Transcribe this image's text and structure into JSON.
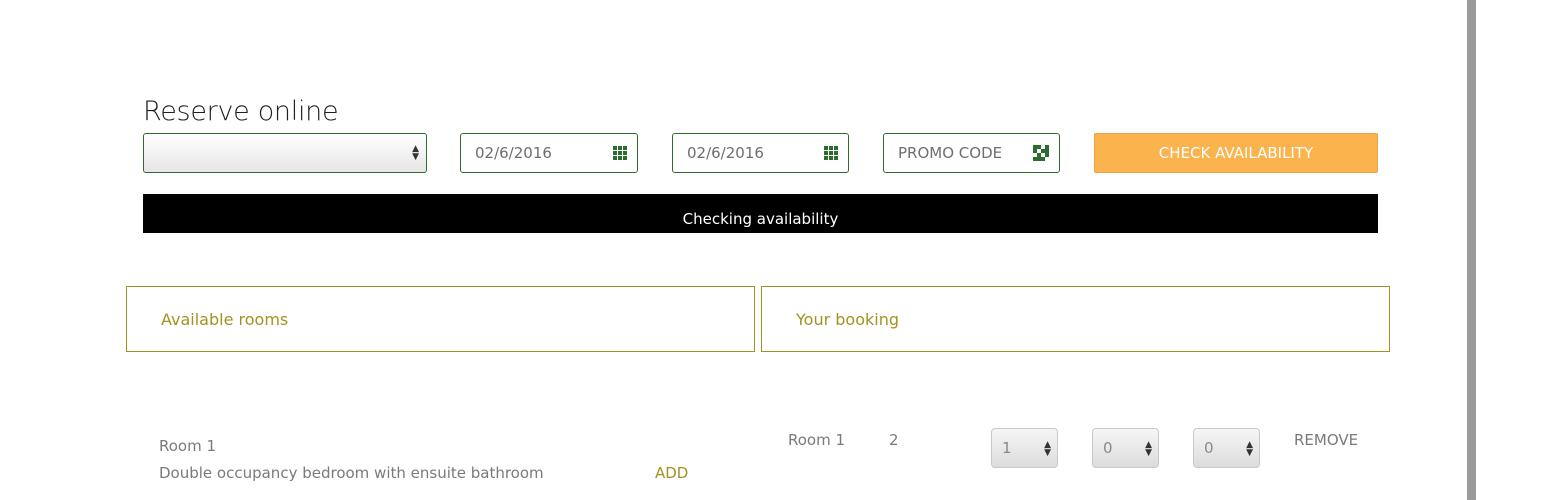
{
  "reserve": {
    "title": "Reserve online",
    "hotel_select_value": "",
    "checkin_date": "02/6/2016",
    "checkout_date": "02/6/2016",
    "promo_placeholder": "PROMO CODE",
    "check_button": "CHECK AVAILABILITY",
    "status_text": "Checking availability"
  },
  "panels": {
    "available_rooms": "Available rooms",
    "your_booking": "Your booking"
  },
  "room": {
    "name": "Room 1",
    "description": "Double occupancy bedroom with ensuite bathroom",
    "add_label": "ADD"
  },
  "booking": {
    "room_name": "Room 1",
    "count": "2",
    "select1": "1",
    "select2": "0",
    "select3": "0",
    "remove_label": "REMOVE"
  },
  "colors": {
    "accent_green": "#2e6b2e",
    "gold": "#a3921f",
    "button_orange": "#fbb34d"
  }
}
